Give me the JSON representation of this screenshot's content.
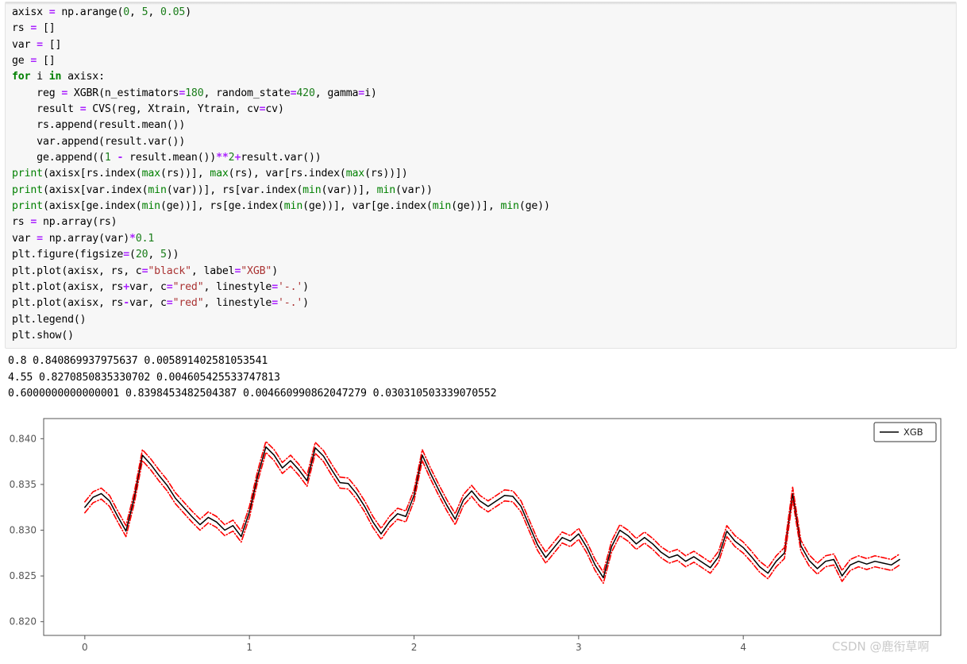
{
  "notebook": {
    "code_lines": [
      [
        {
          "t": "axisx ",
          "c": ""
        },
        {
          "t": "=",
          "c": "op"
        },
        {
          "t": " np.arange(",
          "c": ""
        },
        {
          "t": "0",
          "c": "num"
        },
        {
          "t": ", ",
          "c": ""
        },
        {
          "t": "5",
          "c": "num"
        },
        {
          "t": ", ",
          "c": ""
        },
        {
          "t": "0.05",
          "c": "num"
        },
        {
          "t": ")",
          "c": ""
        }
      ],
      [
        {
          "t": "rs ",
          "c": ""
        },
        {
          "t": "=",
          "c": "op"
        },
        {
          "t": " []",
          "c": ""
        }
      ],
      [
        {
          "t": "var ",
          "c": ""
        },
        {
          "t": "=",
          "c": "op"
        },
        {
          "t": " []",
          "c": ""
        }
      ],
      [
        {
          "t": "ge ",
          "c": ""
        },
        {
          "t": "=",
          "c": "op"
        },
        {
          "t": " []",
          "c": ""
        }
      ],
      [
        {
          "t": "for",
          "c": "k"
        },
        {
          "t": " i ",
          "c": ""
        },
        {
          "t": "in",
          "c": "k"
        },
        {
          "t": " axisx:",
          "c": ""
        }
      ],
      [
        {
          "t": "    reg ",
          "c": ""
        },
        {
          "t": "=",
          "c": "op"
        },
        {
          "t": " XGBR(n_estimators",
          "c": ""
        },
        {
          "t": "=",
          "c": "op"
        },
        {
          "t": "180",
          "c": "num"
        },
        {
          "t": ", random_state",
          "c": ""
        },
        {
          "t": "=",
          "c": "op"
        },
        {
          "t": "420",
          "c": "num"
        },
        {
          "t": ", gamma",
          "c": ""
        },
        {
          "t": "=",
          "c": "op"
        },
        {
          "t": "i)",
          "c": ""
        }
      ],
      [
        {
          "t": "    result ",
          "c": ""
        },
        {
          "t": "=",
          "c": "op"
        },
        {
          "t": " CVS(reg, Xtrain, Ytrain, cv",
          "c": ""
        },
        {
          "t": "=",
          "c": "op"
        },
        {
          "t": "cv)",
          "c": ""
        }
      ],
      [
        {
          "t": "    rs.append(result.mean())",
          "c": ""
        }
      ],
      [
        {
          "t": "    var.append(result.var())",
          "c": ""
        }
      ],
      [
        {
          "t": "    ge.append((",
          "c": ""
        },
        {
          "t": "1",
          "c": "num"
        },
        {
          "t": " ",
          "c": ""
        },
        {
          "t": "-",
          "c": "op"
        },
        {
          "t": " result.mean())",
          "c": ""
        },
        {
          "t": "**",
          "c": "op"
        },
        {
          "t": "2",
          "c": "num"
        },
        {
          "t": "+",
          "c": "op"
        },
        {
          "t": "result.var())",
          "c": ""
        }
      ],
      [
        {
          "t": "print",
          "c": "bi"
        },
        {
          "t": "(axisx[rs.index(",
          "c": ""
        },
        {
          "t": "max",
          "c": "bi"
        },
        {
          "t": "(rs))], ",
          "c": ""
        },
        {
          "t": "max",
          "c": "bi"
        },
        {
          "t": "(rs), var[rs.index(",
          "c": ""
        },
        {
          "t": "max",
          "c": "bi"
        },
        {
          "t": "(rs))])",
          "c": ""
        }
      ],
      [
        {
          "t": "print",
          "c": "bi"
        },
        {
          "t": "(axisx[var.index(",
          "c": ""
        },
        {
          "t": "min",
          "c": "bi"
        },
        {
          "t": "(var))], rs[var.index(",
          "c": ""
        },
        {
          "t": "min",
          "c": "bi"
        },
        {
          "t": "(var))], ",
          "c": ""
        },
        {
          "t": "min",
          "c": "bi"
        },
        {
          "t": "(var))",
          "c": ""
        }
      ],
      [
        {
          "t": "print",
          "c": "bi"
        },
        {
          "t": "(axisx[ge.index(",
          "c": ""
        },
        {
          "t": "min",
          "c": "bi"
        },
        {
          "t": "(ge))], rs[ge.index(",
          "c": ""
        },
        {
          "t": "min",
          "c": "bi"
        },
        {
          "t": "(ge))], var[ge.index(",
          "c": ""
        },
        {
          "t": "min",
          "c": "bi"
        },
        {
          "t": "(ge))], ",
          "c": ""
        },
        {
          "t": "min",
          "c": "bi"
        },
        {
          "t": "(ge))",
          "c": ""
        }
      ],
      [
        {
          "t": "rs ",
          "c": ""
        },
        {
          "t": "=",
          "c": "op"
        },
        {
          "t": " np.array(rs)",
          "c": ""
        }
      ],
      [
        {
          "t": "var ",
          "c": ""
        },
        {
          "t": "=",
          "c": "op"
        },
        {
          "t": " np.array(var)",
          "c": ""
        },
        {
          "t": "*",
          "c": "op"
        },
        {
          "t": "0.1",
          "c": "num"
        }
      ],
      [
        {
          "t": "plt.figure(figsize",
          "c": ""
        },
        {
          "t": "=",
          "c": "op"
        },
        {
          "t": "(",
          "c": ""
        },
        {
          "t": "20",
          "c": "num"
        },
        {
          "t": ", ",
          "c": ""
        },
        {
          "t": "5",
          "c": "num"
        },
        {
          "t": "))",
          "c": ""
        }
      ],
      [
        {
          "t": "plt.plot(axisx, rs, c",
          "c": ""
        },
        {
          "t": "=",
          "c": "op"
        },
        {
          "t": "\"black\"",
          "c": "str"
        },
        {
          "t": ", label",
          "c": ""
        },
        {
          "t": "=",
          "c": "op"
        },
        {
          "t": "\"XGB\"",
          "c": "str"
        },
        {
          "t": ")",
          "c": ""
        }
      ],
      [
        {
          "t": "plt.plot(axisx, rs",
          "c": ""
        },
        {
          "t": "+",
          "c": "op"
        },
        {
          "t": "var, c",
          "c": ""
        },
        {
          "t": "=",
          "c": "op"
        },
        {
          "t": "\"red\"",
          "c": "str"
        },
        {
          "t": ", linestyle",
          "c": ""
        },
        {
          "t": "=",
          "c": "op"
        },
        {
          "t": "'-.'",
          "c": "str"
        },
        {
          "t": ")",
          "c": ""
        }
      ],
      [
        {
          "t": "plt.plot(axisx, rs",
          "c": ""
        },
        {
          "t": "-",
          "c": "op"
        },
        {
          "t": "var, c",
          "c": ""
        },
        {
          "t": "=",
          "c": "op"
        },
        {
          "t": "\"red\"",
          "c": "str"
        },
        {
          "t": ", linestyle",
          "c": ""
        },
        {
          "t": "=",
          "c": "op"
        },
        {
          "t": "'-.'",
          "c": "str"
        },
        {
          "t": ")",
          "c": ""
        }
      ],
      [
        {
          "t": "plt.legend()",
          "c": ""
        }
      ],
      [
        {
          "t": "plt.show()",
          "c": ""
        }
      ]
    ],
    "stdout_lines": [
      "0.8 0.840869937975637 0.005891402581053541",
      "4.55 0.8270850835330702 0.004605425533747813",
      "0.6000000000000001 0.8398453482504387 0.004660990862047279 0.030310503339070552"
    ],
    "watermark": "CSDN @鹿衔草啊"
  },
  "chart_data": {
    "type": "line",
    "title": "",
    "xlabel": "",
    "ylabel": "",
    "xlim": [
      -0.25,
      5.2
    ],
    "ylim": [
      0.8185,
      0.8422
    ],
    "xticks": [
      0,
      1,
      2,
      3,
      4
    ],
    "yticks": [
      0.82,
      0.825,
      0.83,
      0.835,
      0.84
    ],
    "ytick_labels": [
      "0.820",
      "0.825",
      "0.830",
      "0.835",
      "0.840"
    ],
    "xtick_labels": [
      "0",
      "1",
      "2",
      "3",
      "4"
    ],
    "grid": false,
    "legend": {
      "position": "upper right",
      "entries": [
        {
          "label": "XGB",
          "color": "#000000",
          "style": "solid"
        }
      ]
    },
    "colors": {
      "mean": "#000000",
      "band": "#ff0000",
      "axis": "#555555",
      "tick_label": "#555555"
    },
    "band_style": "dashdot",
    "x": [
      0.0,
      0.05,
      0.1,
      0.15,
      0.2,
      0.25,
      0.3,
      0.35,
      0.4,
      0.45,
      0.5,
      0.55,
      0.6,
      0.65,
      0.7,
      0.75,
      0.8,
      0.85,
      0.9,
      0.95,
      1.0,
      1.05,
      1.1,
      1.15,
      1.2,
      1.25,
      1.3,
      1.35,
      1.4,
      1.45,
      1.5,
      1.55,
      1.6,
      1.65,
      1.7,
      1.75,
      1.8,
      1.85,
      1.9,
      1.95,
      2.0,
      2.05,
      2.1,
      2.15,
      2.2,
      2.25,
      2.3,
      2.35,
      2.4,
      2.45,
      2.5,
      2.55,
      2.6,
      2.65,
      2.7,
      2.75,
      2.8,
      2.85,
      2.9,
      2.95,
      3.0,
      3.05,
      3.1,
      3.15,
      3.2,
      3.25,
      3.3,
      3.35,
      3.4,
      3.45,
      3.5,
      3.55,
      3.6,
      3.65,
      3.7,
      3.75,
      3.8,
      3.85,
      3.9,
      3.95,
      4.0,
      4.05,
      4.1,
      4.15,
      4.2,
      4.25,
      4.3,
      4.35,
      4.4,
      4.45,
      4.5,
      4.55,
      4.6,
      4.65,
      4.7,
      4.75,
      4.8,
      4.85,
      4.9,
      4.95
    ],
    "series": [
      {
        "name": "XGB",
        "color": "#000000",
        "style": "solid",
        "values": [
          0.8325,
          0.8336,
          0.834,
          0.8332,
          0.8315,
          0.8299,
          0.8335,
          0.8382,
          0.8372,
          0.836,
          0.8349,
          0.8335,
          0.8325,
          0.8315,
          0.8306,
          0.8314,
          0.8309,
          0.83,
          0.8305,
          0.8293,
          0.832,
          0.8359,
          0.8391,
          0.8382,
          0.8368,
          0.8376,
          0.8366,
          0.8354,
          0.839,
          0.8381,
          0.8366,
          0.8352,
          0.8351,
          0.834,
          0.8326,
          0.8309,
          0.8296,
          0.8309,
          0.8318,
          0.8315,
          0.8338,
          0.8382,
          0.8362,
          0.8344,
          0.8327,
          0.8312,
          0.8333,
          0.8343,
          0.8332,
          0.8326,
          0.8332,
          0.8338,
          0.8337,
          0.8326,
          0.8305,
          0.8284,
          0.827,
          0.8281,
          0.8292,
          0.8288,
          0.8296,
          0.8281,
          0.8262,
          0.8248,
          0.8282,
          0.83,
          0.8294,
          0.8285,
          0.8292,
          0.8285,
          0.8276,
          0.827,
          0.8273,
          0.8266,
          0.8271,
          0.8265,
          0.8259,
          0.8271,
          0.8299,
          0.8288,
          0.8281,
          0.8271,
          0.826,
          0.8253,
          0.8266,
          0.8275,
          0.834,
          0.8283,
          0.8267,
          0.8258,
          0.8266,
          0.8268,
          0.825,
          0.8262,
          0.8266,
          0.8263,
          0.8266,
          0.8264,
          0.8262,
          0.8268
        ]
      },
      {
        "name": "rs+var",
        "color": "#ff0000",
        "style": "dashdot",
        "values": [
          0.8331,
          0.8342,
          0.8346,
          0.8338,
          0.8321,
          0.8305,
          0.8341,
          0.8388,
          0.8378,
          0.8366,
          0.8355,
          0.8341,
          0.8331,
          0.8321,
          0.8312,
          0.832,
          0.8315,
          0.8306,
          0.8311,
          0.8299,
          0.8326,
          0.8365,
          0.8397,
          0.8388,
          0.8374,
          0.8382,
          0.8372,
          0.836,
          0.8396,
          0.8387,
          0.8372,
          0.8358,
          0.8357,
          0.8346,
          0.8332,
          0.8315,
          0.8302,
          0.8315,
          0.8324,
          0.8321,
          0.8344,
          0.8388,
          0.8368,
          0.835,
          0.8333,
          0.8318,
          0.8339,
          0.8349,
          0.8338,
          0.8332,
          0.8338,
          0.8344,
          0.8343,
          0.8332,
          0.8311,
          0.829,
          0.8276,
          0.8287,
          0.8298,
          0.8294,
          0.8302,
          0.8287,
          0.8268,
          0.8254,
          0.8288,
          0.8306,
          0.83,
          0.8291,
          0.8298,
          0.8291,
          0.8282,
          0.8276,
          0.8279,
          0.8272,
          0.8277,
          0.8271,
          0.8265,
          0.8277,
          0.8305,
          0.8294,
          0.8287,
          0.8277,
          0.8266,
          0.8259,
          0.8272,
          0.8281,
          0.8347,
          0.8289,
          0.8273,
          0.8264,
          0.8272,
          0.8274,
          0.8256,
          0.8268,
          0.8272,
          0.8269,
          0.8272,
          0.827,
          0.8268,
          0.8274
        ]
      },
      {
        "name": "rs-var",
        "color": "#ff0000",
        "style": "dashdot",
        "values": [
          0.8319,
          0.833,
          0.8334,
          0.8326,
          0.8309,
          0.8293,
          0.8329,
          0.8376,
          0.8366,
          0.8354,
          0.8343,
          0.8329,
          0.8319,
          0.8309,
          0.83,
          0.8308,
          0.8303,
          0.8294,
          0.8299,
          0.8287,
          0.8314,
          0.8353,
          0.8385,
          0.8376,
          0.8362,
          0.837,
          0.836,
          0.8348,
          0.8384,
          0.8375,
          0.836,
          0.8346,
          0.8345,
          0.8334,
          0.832,
          0.8303,
          0.829,
          0.8303,
          0.8312,
          0.8309,
          0.8332,
          0.8376,
          0.8356,
          0.8338,
          0.8321,
          0.8306,
          0.8327,
          0.8337,
          0.8326,
          0.832,
          0.8326,
          0.8332,
          0.8331,
          0.832,
          0.8299,
          0.8278,
          0.8264,
          0.8275,
          0.8286,
          0.8282,
          0.829,
          0.8275,
          0.8256,
          0.8242,
          0.8276,
          0.8294,
          0.8288,
          0.8279,
          0.8286,
          0.8279,
          0.827,
          0.8264,
          0.8267,
          0.826,
          0.8265,
          0.8259,
          0.8253,
          0.8265,
          0.8293,
          0.8282,
          0.8275,
          0.8265,
          0.8254,
          0.8247,
          0.826,
          0.8269,
          0.8333,
          0.8277,
          0.8261,
          0.8252,
          0.826,
          0.8262,
          0.8244,
          0.8256,
          0.826,
          0.8257,
          0.826,
          0.8258,
          0.8256,
          0.8262
        ]
      }
    ]
  }
}
